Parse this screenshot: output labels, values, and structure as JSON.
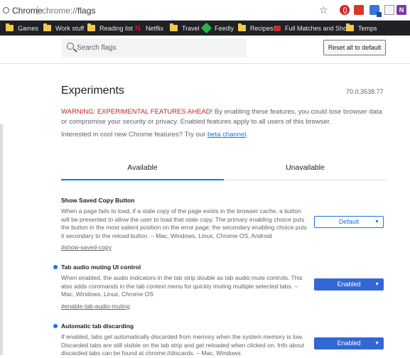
{
  "omnibox": {
    "chip": "Chrome",
    "url_scheme": "chrome://",
    "url_path": "flags"
  },
  "bookmarks": [
    {
      "label": "Games",
      "icon": "folder-icon"
    },
    {
      "label": "Work stuff",
      "icon": "folder-icon"
    },
    {
      "label": "Reading list",
      "icon": "folder-icon"
    },
    {
      "label": "Netflix",
      "icon": "netflix-icon"
    },
    {
      "label": "Travel",
      "icon": "folder-icon"
    },
    {
      "label": "Feedly",
      "icon": "feedly-icon"
    },
    {
      "label": "Recipes",
      "icon": "folder-icon"
    },
    {
      "label": "Full Matches and Sho",
      "icon": "video-icon"
    },
    {
      "label": "Temps",
      "icon": "folder-icon"
    }
  ],
  "search": {
    "placeholder": "Search flags",
    "reset_label": "Reset all to default"
  },
  "header": {
    "title": "Experiments",
    "version": "70.0.3538.77",
    "warning_red": "WARNING: EXPERIMENTAL FEATURES AHEAD!",
    "warning_rest": " By enabling these features, you could lose browser data or compromise your security or privacy. Enabled features apply to all users of this browser.",
    "interest_text": "Interested in cool new Chrome features? Try our ",
    "interest_link": "beta channel",
    "interest_end": "."
  },
  "tabs": {
    "available": "Available",
    "unavailable": "Unavailable"
  },
  "experiments": [
    {
      "title": "Show Saved Copy Button",
      "description": "When a page fails to load, if a stale copy of the page exists in the browser cache, a button will be presented to allow the user to load that stale copy. The primary enabling choice puts the button in the most salient position on the error page; the secondary enabling choice puts it secondary to the reload button. – Mac, Windows, Linux, Chrome OS, Android",
      "link": "#show-saved-copy",
      "value": "Default",
      "modified": false
    },
    {
      "title": "Tab audio muting UI control",
      "description": "When enabled, the audio indicators in the tab strip double as tab audio mute controls. This also adds commands in the tab context menu for quickly muting multiple selected tabs. – Mac, Windows, Linux, Chrome OS",
      "link": "#enable-tab-audio-muting",
      "value": "Enabled",
      "modified": true
    },
    {
      "title": "Automatic tab discarding",
      "description": "If enabled, tabs get automatically discarded from memory when the system memory is low. Discarded tabs are still visible on the tab strip and get reloaded when clicked on. Info about discarded tabs can be found at chrome://discards. – Mac, Windows",
      "link": "",
      "value": "Enabled",
      "modified": true
    }
  ],
  "colors": {
    "accent": "#1a73e8",
    "enabled_bg": "#3367d6",
    "warning": "#c5221f"
  }
}
